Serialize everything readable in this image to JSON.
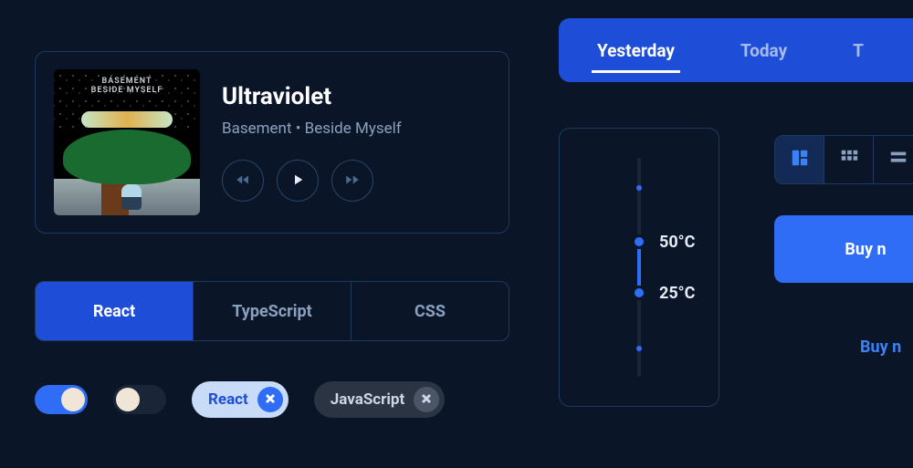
{
  "music": {
    "album_line1": "BASEMENT",
    "album_line2": "BESIDE MYSELF",
    "title": "Ultraviolet",
    "subtitle": "Basement • Beside Myself"
  },
  "segmented": {
    "items": [
      "React",
      "TypeScript",
      "CSS"
    ],
    "active_index": 0
  },
  "toggles": {
    "a_on": true,
    "b_on": false
  },
  "chips": {
    "primary_label": "React",
    "secondary_label": "JavaScript"
  },
  "tabs": {
    "items": [
      "Yesterday",
      "Today",
      "T"
    ],
    "active_index": 0
  },
  "temperature": {
    "high_label": "50°C",
    "low_label": "25°C",
    "high_value": 50,
    "low_value": 25
  },
  "view_toggle": {
    "active_index": 0
  },
  "buy": {
    "primary_label": "Buy n",
    "ghost_label": "Buy n"
  },
  "colors": {
    "bg": "#0a1628",
    "accent": "#2f6df6",
    "accent_dark": "#1e4dd8",
    "border": "#1e3a5f",
    "muted": "#8ba0bd"
  }
}
